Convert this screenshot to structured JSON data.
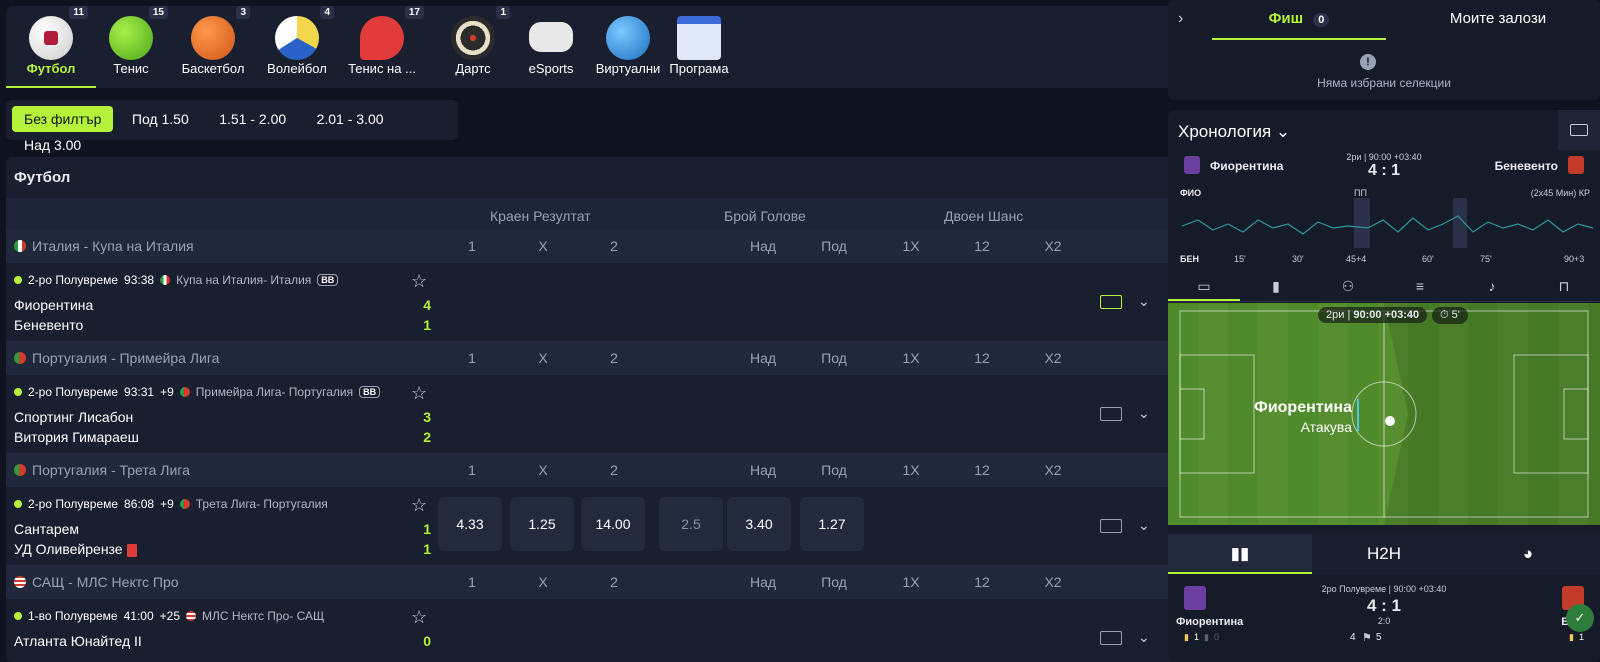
{
  "sports": [
    {
      "label": "Футбол",
      "count": "11",
      "icon": "football-icon",
      "color": "#f4f4f4",
      "active": true
    },
    {
      "label": "Тенис",
      "count": "15",
      "icon": "tennis-ball-icon",
      "color": "#7ed321"
    },
    {
      "label": "Баскетбол",
      "count": "3",
      "icon": "basketball-icon",
      "color": "#f07a2a"
    },
    {
      "label": "Волейбол",
      "count": "4",
      "icon": "volleyball-icon",
      "color": "#f2d64b"
    },
    {
      "label": "Тенис на ...",
      "count": "17",
      "icon": "table-tennis-icon",
      "color": "#e23b3b"
    },
    {
      "label": "Дартс",
      "count": "1",
      "icon": "dartboard-icon",
      "color": "#2b2b2b"
    },
    {
      "label": "eSports",
      "count": "",
      "icon": "gamepad-icon",
      "color": "#e8e8e8"
    },
    {
      "label": "Виртуални",
      "count": "",
      "icon": "virtual-ball-icon",
      "color": "#3aa0e8"
    },
    {
      "label": "Програма",
      "count": "",
      "icon": "calendar-icon",
      "color": "#e0e8f8"
    }
  ],
  "filters": [
    "Без филтър",
    "Под 1.50",
    "1.51 - 2.00",
    "2.01 - 3.00",
    "Над 3.00"
  ],
  "main": {
    "title": "Футбол",
    "headers": {
      "result": "Краен Резултат",
      "goals": "Брой Голове",
      "double": "Двоен Шанс"
    },
    "cols": [
      "1",
      "X",
      "2",
      "Над",
      "Под",
      "1X",
      "12",
      "X2"
    ]
  },
  "leagues": [
    {
      "name": "Италия - Купа на Италия",
      "flag": "#2e9b3f",
      "match": {
        "status": "2-ро Полувреме",
        "time": "93:38",
        "extra": "",
        "league": "Купа на Италия- Италия",
        "bb": "BB",
        "home": "Фиорентина",
        "away": "Беневенто",
        "hs": "4",
        "as": "1",
        "odds": []
      }
    },
    {
      "name": "Португалия - Примейра Лига",
      "flag": "#d23b2b",
      "match": {
        "status": "2-ро Полувреме",
        "time": "93:31",
        "extra": "+9",
        "league": "Примейра Лига- Португалия",
        "bb": "BB",
        "home": "Спортинг Лисабон",
        "away": "Витория Гимараеш",
        "hs": "3",
        "as": "2",
        "odds": []
      }
    },
    {
      "name": "Португалия - Трета Лига",
      "flag": "#d23b2b",
      "match": {
        "status": "2-ро Полувреме",
        "time": "86:08",
        "extra": "+9",
        "league": "Трета Лига- Португалия",
        "bb": "",
        "home": "Сантарем",
        "away": "УД Оливейрензе",
        "hs": "1",
        "as": "1",
        "odds": [
          "4.33",
          "1.25",
          "14.00",
          "2.5",
          "3.40",
          "1.27"
        ]
      }
    },
    {
      "name": "САЩ - МЛС Нектс Про",
      "flag": "#3a5bbf",
      "match": {
        "status": "1-во Полувреме",
        "time": "41:00",
        "extra": "+25",
        "league": "МЛС Нектс Про- САЩ",
        "bb": "",
        "home": "Атланта Юнайтед II",
        "away": "",
        "hs": "0",
        "as": "",
        "odds": []
      }
    }
  ],
  "slip": {
    "tab1": "Фиш",
    "tab1_count": "0",
    "tab2": "Моите залози",
    "empty": "Няма избрани селекции"
  },
  "chrono": {
    "title": "Хронология",
    "home": "Фиорентина",
    "away": "Беневенто",
    "period": "2ри | 90:00 +03:40",
    "score": "4 : 1",
    "home_short": "ФИО",
    "away_short": "БЕН",
    "ht": "ПП",
    "extra": "(2x45 Мин) КР",
    "ticks": [
      "15'",
      "30'",
      "45+4",
      "60'",
      "75'",
      "90+3"
    ],
    "pitch_period": "2ри",
    "pitch_time": "90:00 +03:40",
    "pitch_clock": "5'",
    "attack_team": "Фиорентина",
    "attack_text": "Атакува",
    "h2h": "H2H",
    "bottom_period": "2ро Полувреме | 90:00 +03:40",
    "bottom_score": "4 : 1",
    "bottom_ht": "2:0",
    "bottom_home": "Фиорентина",
    "bottom_away": "Бене",
    "corner_home": "4",
    "corner_away": "5",
    "yc_home": "1",
    "rc_home": "0",
    "yc_away": "1"
  }
}
